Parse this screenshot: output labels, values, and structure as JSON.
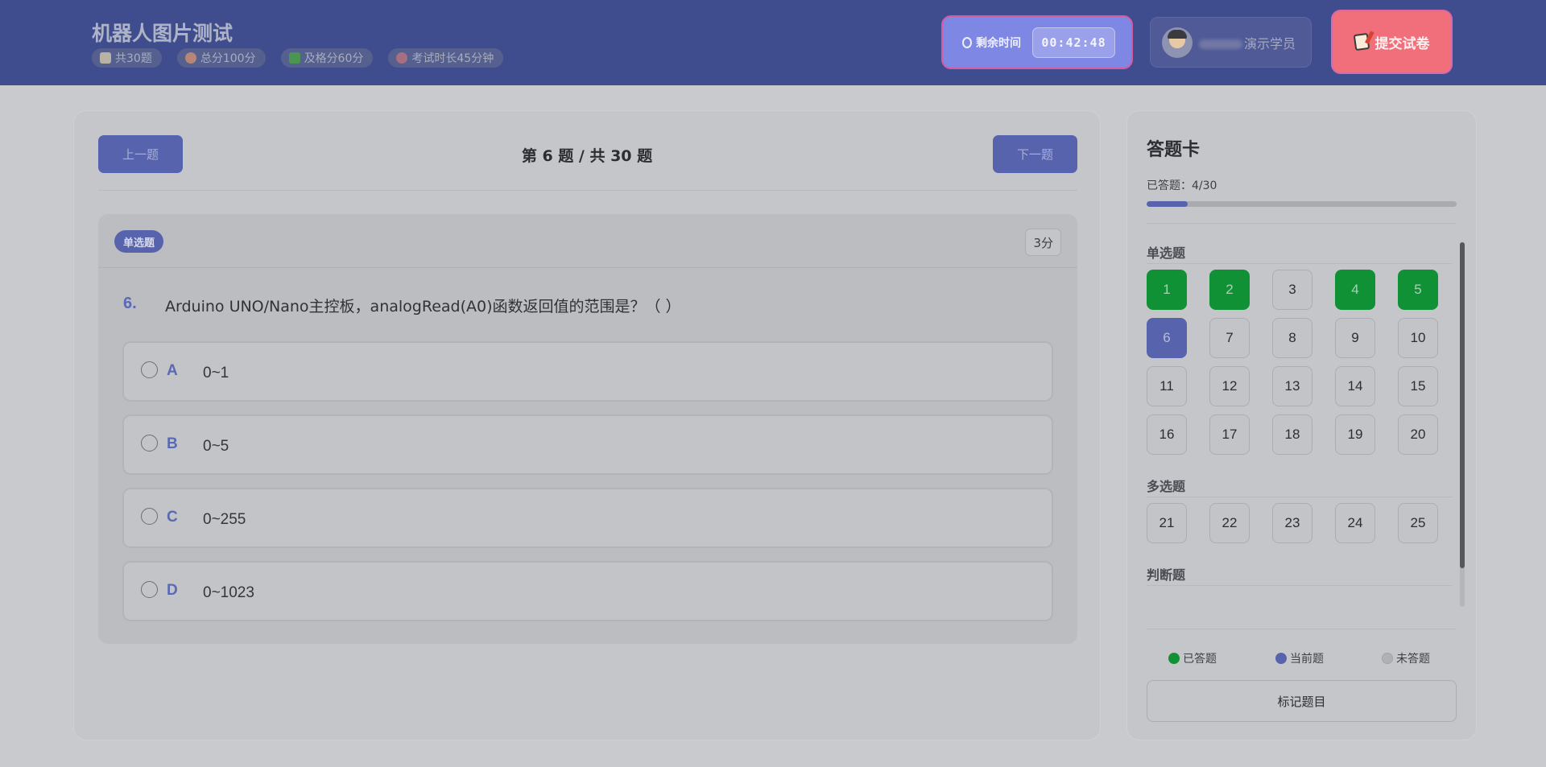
{
  "header": {
    "title": "机器人图片测试",
    "meta": [
      {
        "icon": "book-icon",
        "label": "共30题"
      },
      {
        "icon": "target-icon",
        "label": "总分100分"
      },
      {
        "icon": "check-icon",
        "label": "及格分60分"
      },
      {
        "icon": "alarm-clock-icon",
        "label": "考试时长45分钟"
      }
    ],
    "timer": {
      "label": "剩余时间",
      "value": "00:42:48",
      "icon": "stopwatch-icon"
    },
    "user": {
      "name_suffix": "演示学员"
    },
    "submit_label": "提交试卷"
  },
  "question_panel": {
    "prev_label": "上一题",
    "next_label": "下一题",
    "counter": "第 6 题 / 共 30 题",
    "type_badge": "单选题",
    "score": "3分",
    "number": "6.",
    "text": "Arduino UNO/Nano主控板，analogRead(A0)函数返回值的范围是？（ ）",
    "options": [
      {
        "letter": "A",
        "text": "0~1"
      },
      {
        "letter": "B",
        "text": "0~5"
      },
      {
        "letter": "C",
        "text": "0~255"
      },
      {
        "letter": "D",
        "text": "0~1023"
      }
    ]
  },
  "answer_card": {
    "title": "答题卡",
    "answered_text": "已答题：4/30",
    "progress": 0.133,
    "sections": [
      {
        "label": "单选题",
        "questions": [
          {
            "n": "1",
            "state": "answered"
          },
          {
            "n": "2",
            "state": "answered"
          },
          {
            "n": "3",
            "state": "unanswered"
          },
          {
            "n": "4",
            "state": "answered"
          },
          {
            "n": "5",
            "state": "answered"
          },
          {
            "n": "6",
            "state": "current"
          },
          {
            "n": "7",
            "state": "unanswered"
          },
          {
            "n": "8",
            "state": "unanswered"
          },
          {
            "n": "9",
            "state": "unanswered"
          },
          {
            "n": "10",
            "state": "unanswered"
          },
          {
            "n": "11",
            "state": "unanswered"
          },
          {
            "n": "12",
            "state": "unanswered"
          },
          {
            "n": "13",
            "state": "unanswered"
          },
          {
            "n": "14",
            "state": "unanswered"
          },
          {
            "n": "15",
            "state": "unanswered"
          },
          {
            "n": "16",
            "state": "unanswered"
          },
          {
            "n": "17",
            "state": "unanswered"
          },
          {
            "n": "18",
            "state": "unanswered"
          },
          {
            "n": "19",
            "state": "unanswered"
          },
          {
            "n": "20",
            "state": "unanswered"
          }
        ]
      },
      {
        "label": "多选题",
        "questions": [
          {
            "n": "21",
            "state": "unanswered"
          },
          {
            "n": "22",
            "state": "unanswered"
          },
          {
            "n": "23",
            "state": "unanswered"
          },
          {
            "n": "24",
            "state": "unanswered"
          },
          {
            "n": "25",
            "state": "unanswered"
          }
        ]
      },
      {
        "label": "判断题",
        "questions": []
      }
    ],
    "legend": [
      {
        "key": "answered",
        "label": "已答题"
      },
      {
        "key": "current",
        "label": "当前题"
      },
      {
        "key": "unanswered",
        "label": "未答题"
      }
    ],
    "mark_label": "标记题目"
  },
  "colors": {
    "accent": "#5763ad",
    "answered": "#119135",
    "header": "#3f4d8f",
    "submit": "#f06f7a"
  }
}
